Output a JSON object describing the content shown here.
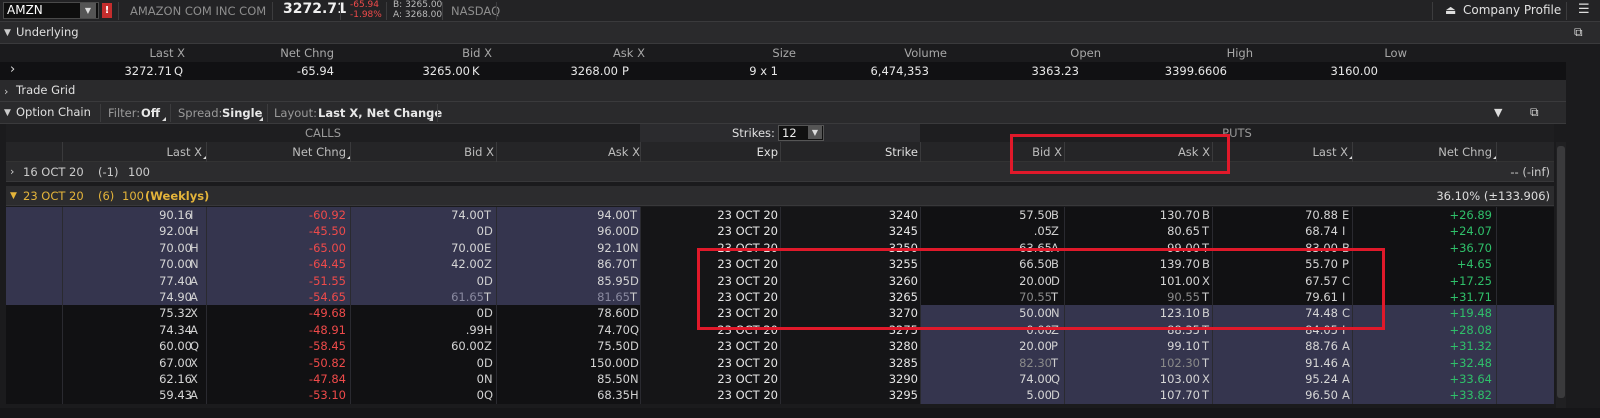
{
  "topbar": {
    "symbol": "AMZN",
    "alert_label": "!",
    "company": "AMAZON COM INC COM",
    "price": "3272.71",
    "net_change": "-65.94",
    "pct_change": "-1.98%",
    "bid": "B: 3265.00",
    "ask": "A: 3268.00",
    "exchange": "NASDAQ",
    "company_profile": "Company Profile"
  },
  "underlying": {
    "title": "Underlying",
    "headers": [
      "Last X",
      "Net Chng",
      "Bid X",
      "Ask X",
      "Size",
      "Volume",
      "Open",
      "High",
      "Low"
    ],
    "last": "3272.71",
    "last_ex": "Q",
    "net_chng": "-65.94",
    "bid": "3265.00",
    "bid_ex": "K",
    "ask": "3268.00",
    "ask_ex": "P",
    "size": "9 x 1",
    "volume": "6,474,353",
    "open": "3363.23",
    "high": "3399.6606",
    "low": "3160.00"
  },
  "trade_grid": {
    "title": "Trade Grid"
  },
  "option_chain": {
    "title": "Option Chain",
    "filter_label": "Filter:",
    "filter_value": "Off",
    "spread_label": "Spread:",
    "spread_value": "Single",
    "layout_label": "Layout:",
    "layout_value": "Last X, Net Change",
    "calls_label": "CALLS",
    "puts_label": "PUTS",
    "strikes_label": "Strikes:",
    "strikes_value": "12",
    "call_headers": [
      "Last X",
      "Net Chng",
      "Bid X",
      "Ask X"
    ],
    "mid_headers": [
      "Exp",
      "Strike"
    ],
    "put_headers": [
      "Bid X",
      "Ask X",
      "Last X",
      "Net Chng"
    ],
    "groups": [
      {
        "date": "16 OCT 20",
        "days": "(-1)",
        "mult": "100",
        "weekly": "",
        "iv": "-- (-inf)"
      },
      {
        "date": "23 OCT 20",
        "days": "(6)",
        "mult": "100",
        "weekly": "(Weeklys)",
        "iv": "36.10% (±133.906)"
      }
    ],
    "rows": [
      {
        "c_last": "90.16",
        "c_last_ex": "I",
        "c_chg": "-60.92",
        "c_bid": "74.00",
        "c_bid_ex": "T",
        "c_ask": "94.00",
        "c_ask_ex": "T",
        "exp": "23 OCT 20",
        "strike": "3240",
        "p_bid": "57.50",
        "p_bid_ex": "B",
        "p_ask": "130.70",
        "p_ask_ex": "B",
        "p_last": "70.88",
        "p_last_ex": "E",
        "p_chg": "+26.89"
      },
      {
        "c_last": "92.00",
        "c_last_ex": "H",
        "c_chg": "-45.50",
        "c_bid": "0",
        "c_bid_ex": "D",
        "c_ask": "96.00",
        "c_ask_ex": "D",
        "exp": "23 OCT 20",
        "strike": "3245",
        "p_bid": ".05",
        "p_bid_ex": "Z",
        "p_ask": "80.65",
        "p_ask_ex": "T",
        "p_last": "68.74",
        "p_last_ex": "I",
        "p_chg": "+24.07"
      },
      {
        "c_last": "70.00",
        "c_last_ex": "H",
        "c_chg": "-65.00",
        "c_bid": "70.00",
        "c_bid_ex": "E",
        "c_ask": "92.10",
        "c_ask_ex": "N",
        "exp": "23 OCT 20",
        "strike": "3250",
        "p_bid": "63.65",
        "p_bid_ex": "A",
        "p_ask": "99.00",
        "p_ask_ex": "T",
        "p_last": "83.00",
        "p_last_ex": "B",
        "p_chg": "+36.70"
      },
      {
        "c_last": "70.00",
        "c_last_ex": "N",
        "c_chg": "-64.45",
        "c_bid": "42.00",
        "c_bid_ex": "Z",
        "c_ask": "86.70",
        "c_ask_ex": "T",
        "exp": "23 OCT 20",
        "strike": "3255",
        "p_bid": "66.50",
        "p_bid_ex": "B",
        "p_ask": "139.70",
        "p_ask_ex": "B",
        "p_last": "55.70",
        "p_last_ex": "P",
        "p_chg": "+4.65"
      },
      {
        "c_last": "77.40",
        "c_last_ex": "A",
        "c_chg": "-51.55",
        "c_bid": "0",
        "c_bid_ex": "D",
        "c_ask": "85.95",
        "c_ask_ex": "D",
        "exp": "23 OCT 20",
        "strike": "3260",
        "p_bid": "20.00",
        "p_bid_ex": "D",
        "p_ask": "101.00",
        "p_ask_ex": "X",
        "p_last": "67.57",
        "p_last_ex": "C",
        "p_chg": "+17.25"
      },
      {
        "c_last": "74.90",
        "c_last_ex": "A",
        "c_chg": "-54.65",
        "c_bid": "61.65",
        "c_bid_ex": "T",
        "c_ask": "81.65",
        "c_ask_ex": "T",
        "exp": "23 OCT 20",
        "strike": "3265",
        "p_bid": "70.55",
        "p_bid_ex": "T",
        "p_ask": "90.55",
        "p_ask_ex": "T",
        "p_last": "79.61",
        "p_last_ex": "I",
        "p_chg": "+31.71"
      },
      {
        "c_last": "75.32",
        "c_last_ex": "X",
        "c_chg": "-49.68",
        "c_bid": "0",
        "c_bid_ex": "D",
        "c_ask": "78.60",
        "c_ask_ex": "D",
        "exp": "23 OCT 20",
        "strike": "3270",
        "p_bid": "50.00",
        "p_bid_ex": "N",
        "p_ask": "123.10",
        "p_ask_ex": "B",
        "p_last": "74.48",
        "p_last_ex": "C",
        "p_chg": "+19.48"
      },
      {
        "c_last": "74.34",
        "c_last_ex": "A",
        "c_chg": "-48.91",
        "c_bid": ".99",
        "c_bid_ex": "H",
        "c_ask": "74.70",
        "c_ask_ex": "Q",
        "exp": "23 OCT 20",
        "strike": "3275",
        "p_bid": "0.00",
        "p_bid_ex": "Z",
        "p_ask": "88.35",
        "p_ask_ex": "T",
        "p_last": "84.05",
        "p_last_ex": "I",
        "p_chg": "+28.08"
      },
      {
        "c_last": "60.00",
        "c_last_ex": "Q",
        "c_chg": "-58.45",
        "c_bid": "60.00",
        "c_bid_ex": "Z",
        "c_ask": "75.50",
        "c_ask_ex": "D",
        "exp": "23 OCT 20",
        "strike": "3280",
        "p_bid": "20.00",
        "p_bid_ex": "P",
        "p_ask": "99.10",
        "p_ask_ex": "T",
        "p_last": "88.76",
        "p_last_ex": "A",
        "p_chg": "+31.32"
      },
      {
        "c_last": "67.00",
        "c_last_ex": "X",
        "c_chg": "-50.82",
        "c_bid": "0",
        "c_bid_ex": "D",
        "c_ask": "150.00",
        "c_ask_ex": "D",
        "exp": "23 OCT 20",
        "strike": "3285",
        "p_bid": "82.30",
        "p_bid_ex": "T",
        "p_ask": "102.30",
        "p_ask_ex": "T",
        "p_last": "91.46",
        "p_last_ex": "A",
        "p_chg": "+32.48"
      },
      {
        "c_last": "62.16",
        "c_last_ex": "X",
        "c_chg": "-47.84",
        "c_bid": "0",
        "c_bid_ex": "N",
        "c_ask": "85.50",
        "c_ask_ex": "N",
        "exp": "23 OCT 20",
        "strike": "3290",
        "p_bid": "74.00",
        "p_bid_ex": "Q",
        "p_ask": "103.00",
        "p_ask_ex": "X",
        "p_last": "95.24",
        "p_last_ex": "A",
        "p_chg": "+33.64"
      },
      {
        "c_last": "59.43",
        "c_last_ex": "A",
        "c_chg": "-53.10",
        "c_bid": "0",
        "c_bid_ex": "Q",
        "c_ask": "68.35",
        "c_ask_ex": "H",
        "exp": "23 OCT 20",
        "strike": "3295",
        "p_bid": "5.00",
        "p_bid_ex": "D",
        "p_ask": "107.70",
        "p_ask_ex": "T",
        "p_last": "96.50",
        "p_last_ex": "A",
        "p_chg": "+33.82"
      }
    ]
  }
}
